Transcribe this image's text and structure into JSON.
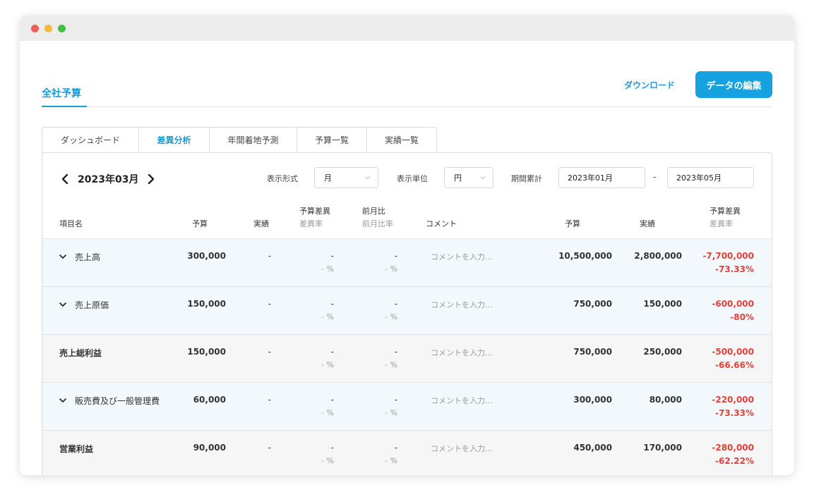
{
  "header": {
    "title": "全社予算",
    "download_label": "ダウンロード",
    "edit_label": "データの編集"
  },
  "tabs": [
    {
      "label": "ダッシュボード",
      "active": false
    },
    {
      "label": "差異分析",
      "active": true
    },
    {
      "label": "年間着地予測",
      "active": false
    },
    {
      "label": "予算一覧",
      "active": false
    },
    {
      "label": "実績一覧",
      "active": false
    }
  ],
  "controls": {
    "month": "2023年03月",
    "display_format_label": "表示形式",
    "display_format_value": "月",
    "display_unit_label": "表示単位",
    "display_unit_value": "円",
    "period_label": "期間累計",
    "period_start": "2023年01月",
    "period_separator": "-",
    "period_end": "2023年05月"
  },
  "columns": {
    "item": "項目名",
    "budget": "予算",
    "actual": "実績",
    "budget_diff": "予算差異",
    "diff_rate": "差異率",
    "mom": "前月比",
    "mom_rate": "前月比率",
    "comment": "コメント",
    "cum_budget": "予算",
    "cum_actual": "実績",
    "cum_budget_diff": "予算差異",
    "cum_diff_rate": "差異率"
  },
  "rows": [
    {
      "name": "売上高",
      "expandable": true,
      "budget": "300,000",
      "actual": "-",
      "diff": "-",
      "diff_rate": "- %",
      "mom": "-",
      "mom_rate": "- %",
      "comment_placeholder": "コメントを入力…",
      "cum_budget": "10,500,000",
      "cum_actual": "2,800,000",
      "cum_diff": "-7,700,000",
      "cum_diff_rate": "-73.33%"
    },
    {
      "name": "売上原価",
      "expandable": true,
      "budget": "150,000",
      "actual": "-",
      "diff": "-",
      "diff_rate": "- %",
      "mom": "-",
      "mom_rate": "- %",
      "comment_placeholder": "コメントを入力…",
      "cum_budget": "750,000",
      "cum_actual": "150,000",
      "cum_diff": "-600,000",
      "cum_diff_rate": "-80%"
    },
    {
      "name": "売上総利益",
      "expandable": false,
      "budget": "150,000",
      "actual": "-",
      "diff": "-",
      "diff_rate": "- %",
      "mom": "-",
      "mom_rate": "- %",
      "comment_placeholder": "コメントを入力…",
      "cum_budget": "750,000",
      "cum_actual": "250,000",
      "cum_diff": "-500,000",
      "cum_diff_rate": "-66.66%"
    },
    {
      "name": "販売費及び一般管理費",
      "expandable": true,
      "budget": "60,000",
      "actual": "-",
      "diff": "-",
      "diff_rate": "- %",
      "mom": "-",
      "mom_rate": "- %",
      "comment_placeholder": "コメントを入力…",
      "cum_budget": "300,000",
      "cum_actual": "80,000",
      "cum_diff": "-220,000",
      "cum_diff_rate": "-73.33%"
    },
    {
      "name": "営業利益",
      "expandable": false,
      "budget": "90,000",
      "actual": "-",
      "diff": "-",
      "diff_rate": "- %",
      "mom": "-",
      "mom_rate": "- %",
      "comment_placeholder": "コメントを入力…",
      "cum_budget": "450,000",
      "cum_actual": "170,000",
      "cum_diff": "-280,000",
      "cum_diff_rate": "-62.22%"
    }
  ],
  "colors": {
    "accent": "#16a2e0",
    "negative": "#e0413a",
    "row_expandable_bg": "#f3f8fc",
    "row_summary_bg": "#f6f6f6"
  }
}
